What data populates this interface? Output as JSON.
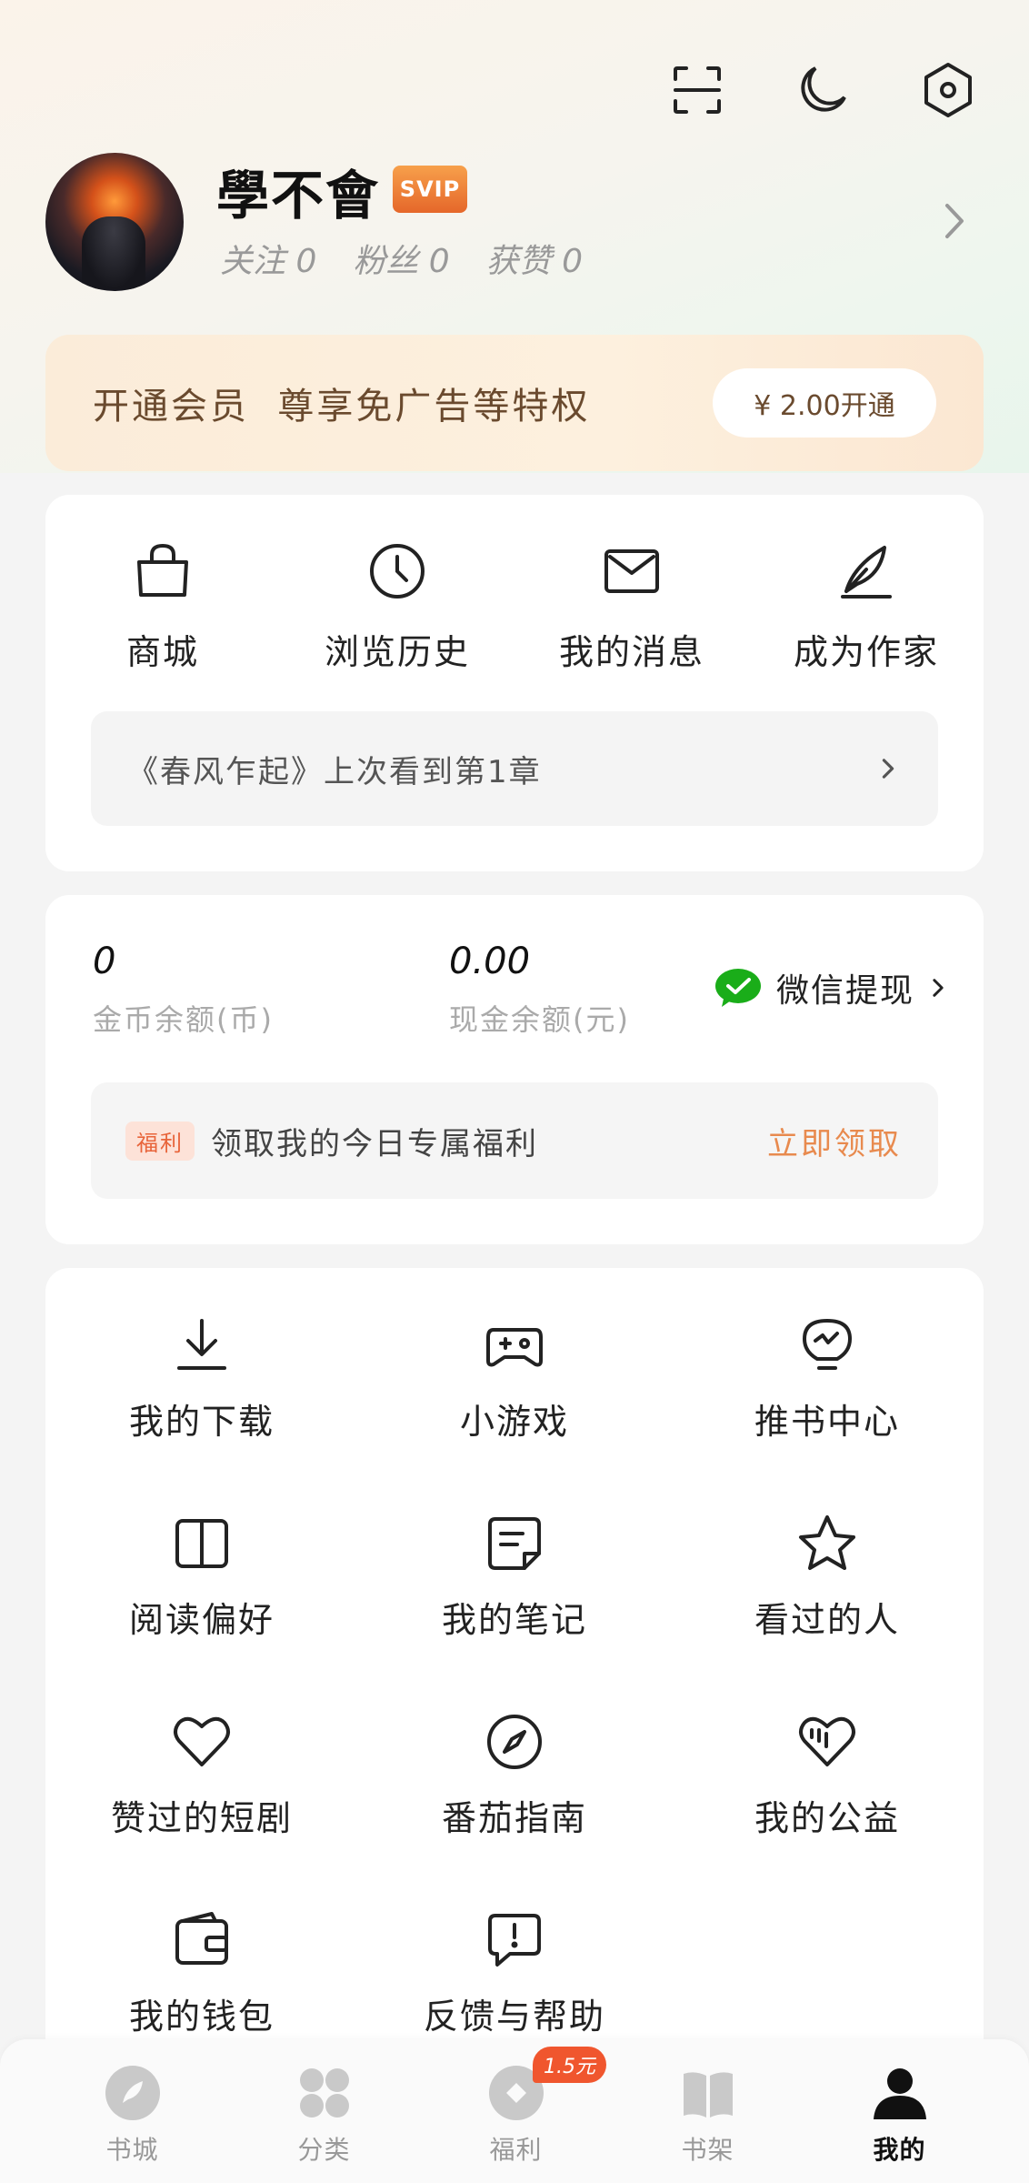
{
  "profile": {
    "username": "學不會",
    "badge": "SVIP",
    "stats": [
      "关注 0",
      "粉丝 0",
      "获赞 0"
    ]
  },
  "vip_banner": {
    "text": "开通会员  尊享免广告等特权",
    "button": "¥ 2.00开通"
  },
  "quick_actions": [
    {
      "label": "商城",
      "icon": "shopping-bag-icon"
    },
    {
      "label": "浏览历史",
      "icon": "clock-icon"
    },
    {
      "label": "我的消息",
      "icon": "mail-icon"
    },
    {
      "label": "成为作家",
      "icon": "quill-icon"
    }
  ],
  "history": {
    "text": "《春风乍起》上次看到第1章"
  },
  "balances": {
    "coins_value": "0",
    "coins_label": "金币余额(币)",
    "cash_value": "0.00",
    "cash_label": "现金余额(元)",
    "wechat_label": "微信提现"
  },
  "benefit": {
    "tag": "福利",
    "text": "领取我的今日专属福利",
    "action": "立即领取"
  },
  "tools": [
    {
      "label": "我的下载",
      "icon": "download-icon"
    },
    {
      "label": "小游戏",
      "icon": "gamepad-icon"
    },
    {
      "label": "推书中心",
      "icon": "lightbulb-icon"
    },
    {
      "label": "阅读偏好",
      "icon": "book-icon"
    },
    {
      "label": "我的笔记",
      "icon": "note-icon"
    },
    {
      "label": "看过的人",
      "icon": "star-icon"
    },
    {
      "label": "赞过的短剧",
      "icon": "heart-icon"
    },
    {
      "label": "番茄指南",
      "icon": "compass-icon"
    },
    {
      "label": "我的公益",
      "icon": "charity-heart-icon"
    },
    {
      "label": "我的钱包",
      "icon": "wallet-icon"
    },
    {
      "label": "反馈与帮助",
      "icon": "feedback-icon"
    }
  ],
  "bottom_nav": [
    {
      "label": "书城",
      "icon": "bookstore-icon"
    },
    {
      "label": "分类",
      "icon": "category-icon"
    },
    {
      "label": "福利",
      "icon": "welfare-icon",
      "badge": "1.5元"
    },
    {
      "label": "书架",
      "icon": "bookshelf-icon"
    },
    {
      "label": "我的",
      "icon": "profile-icon",
      "active": true
    }
  ],
  "colors": {
    "accent_orange": "#e88a4e",
    "badge_red": "#f0562e",
    "wechat_green": "#1aad19",
    "vip_text": "#6a4a2e"
  }
}
